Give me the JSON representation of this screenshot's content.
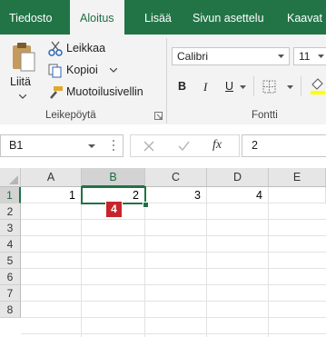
{
  "tabs": [
    {
      "label": "Tiedosto",
      "active": false
    },
    {
      "label": "Aloitus",
      "active": true
    },
    {
      "label": "Lisää",
      "active": false
    },
    {
      "label": "Sivun asettelu",
      "active": false
    },
    {
      "label": "Kaavat",
      "active": false
    }
  ],
  "ribbon": {
    "paste_label": "Liitä",
    "cut_label": "Leikkaa",
    "copy_label": "Kopioi",
    "format_painter_label": "Muotoilusivellin",
    "clipboard_group_label": "Leikepöytä",
    "font_name": "Calibri",
    "font_size": "11",
    "bold_label": "B",
    "italic_label": "I",
    "underline_label": "U",
    "font_group_label": "Fontti"
  },
  "formula_bar": {
    "name_box": "B1",
    "fx_label": "fx",
    "formula_value": "2"
  },
  "sheet": {
    "corner": "",
    "columns": [
      "A",
      "B",
      "C",
      "D",
      "E"
    ],
    "rows": [
      "1",
      "2",
      "3",
      "4",
      "5",
      "6",
      "7",
      "8"
    ],
    "row1_values": [
      "1",
      "2",
      "3",
      "4",
      ""
    ],
    "selected_cell": "B1",
    "badge": "4",
    "selection_color": "#217346",
    "badge_color": "#c8242b"
  },
  "colors": {
    "brand": "#227447",
    "ribbon_bg": "#f3f3f3"
  }
}
